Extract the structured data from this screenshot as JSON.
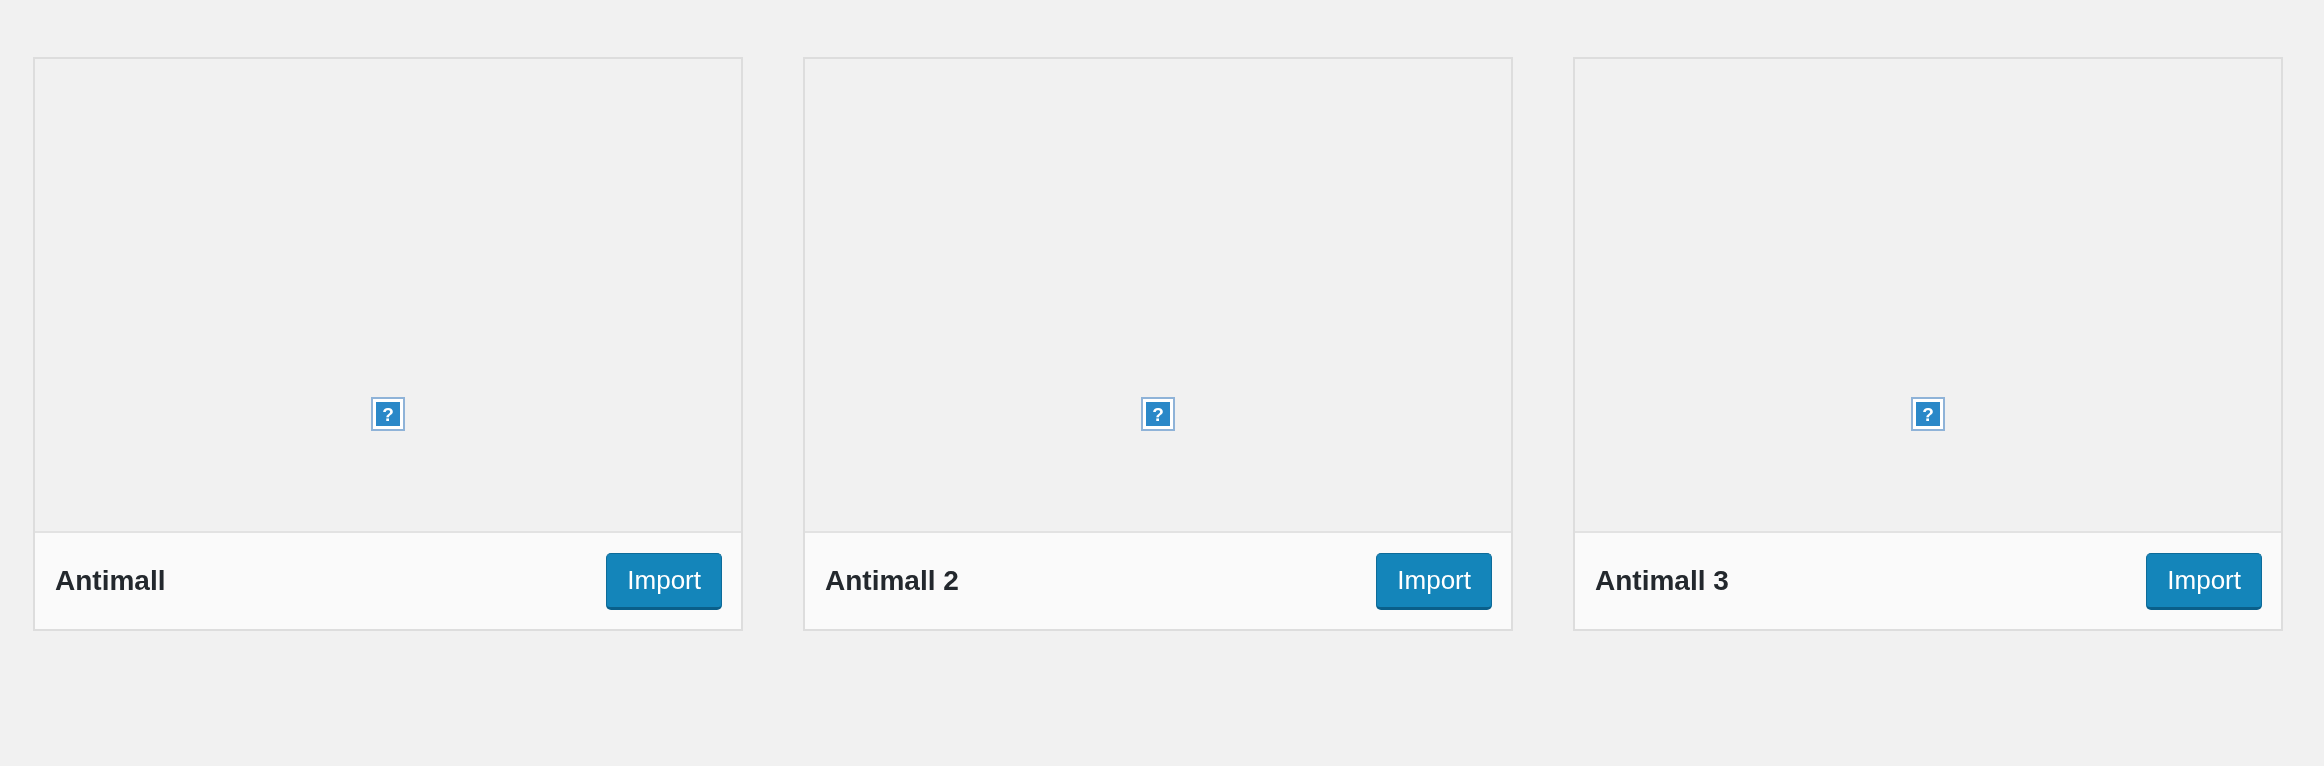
{
  "templates": [
    {
      "name": "Antimall",
      "preview": {
        "kind": "broken-image",
        "icon": "?"
      },
      "button": "Import"
    },
    {
      "name": "Antimall 2",
      "preview": {
        "kind": "broken-image",
        "icon": "?"
      },
      "button": "Import"
    },
    {
      "name": "Antimall 3",
      "preview": {
        "kind": "broken-image",
        "icon": "?"
      },
      "button": "Import"
    }
  ]
}
